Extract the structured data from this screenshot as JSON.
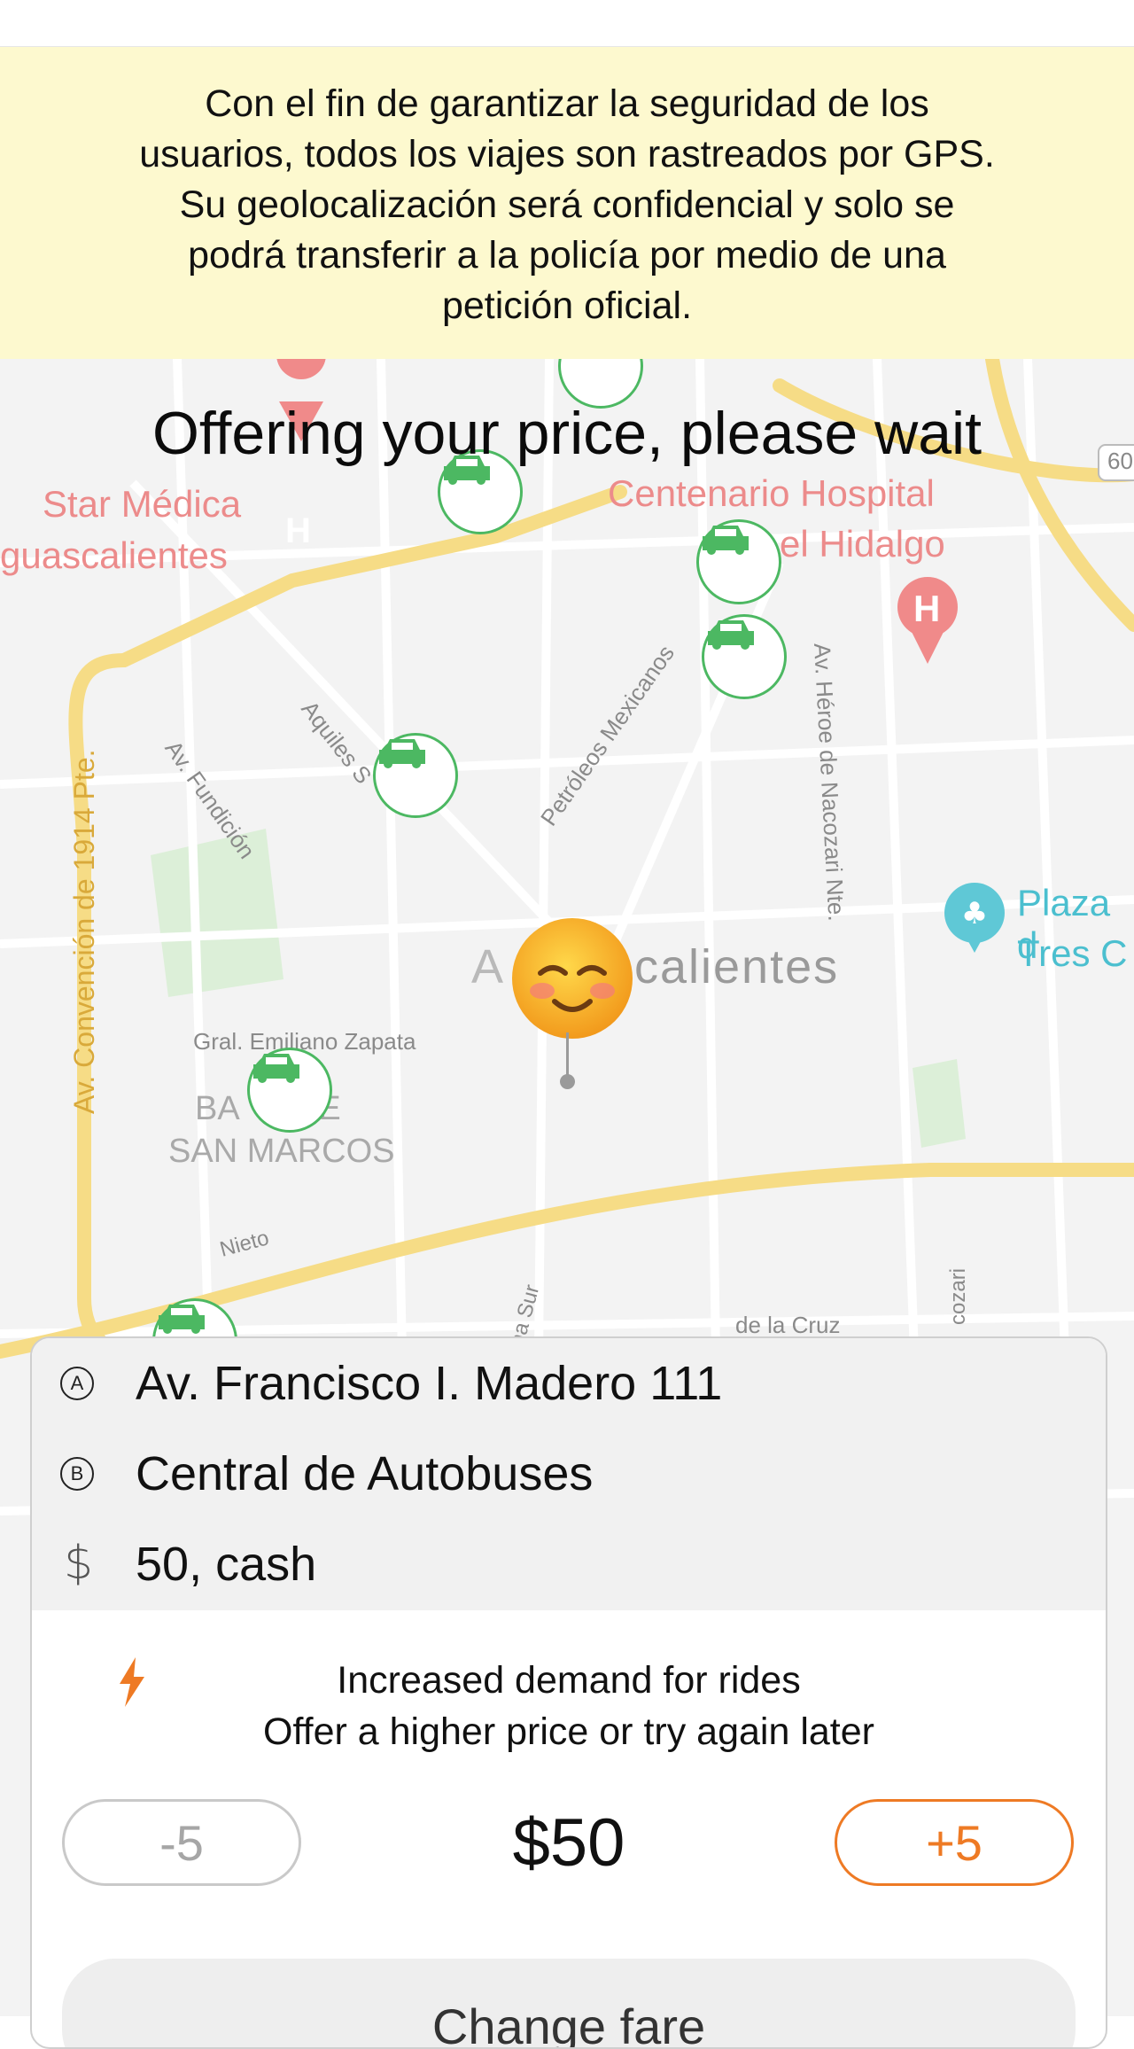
{
  "notice": {
    "line1": "Con el fin de garantizar la seguridad de los",
    "line2": "usuarios, todos los viajes son rastreados por GPS.",
    "line3": "Su geolocalización será confidencial y solo se",
    "line4": "podrá transferir a la policía por medio de una",
    "line5": "petición oficial."
  },
  "status": {
    "title": "Offering your price, please wait"
  },
  "map": {
    "labels": {
      "star_medica": "Star Médica",
      "aguascalientes_left": "guascalientes",
      "centenario": "Centenario Hospital",
      "hidalgo": "el Hidalgo",
      "aquiles": "Aquiles S",
      "fundicion": "Av. Fundición",
      "petroleos": "Petróleos Mexicanos",
      "heroe": "Av. Héroe de Nacozari Nte.",
      "convencion": "Av. Convención de 1914 Pte.",
      "plaza1": "Plaza d",
      "plaza2": "Tres C",
      "city_a": "A",
      "city_b": "calientes",
      "zapata": "Gral. Emiliano Zapata",
      "barrio1": "BA      DE",
      "barrio2": "SAN MARCOS",
      "nieto": "Nieto",
      "cruz": "de la Cruz",
      "sur": "na Sur",
      "cozari": "cozari",
      "road60": "60",
      "hospital_glyph": "H"
    },
    "colors": {
      "road": "#f6dc86",
      "poi": "#f08a8a",
      "water": "#5fc8d6",
      "park": "#dcefd8",
      "car": "#4cb862"
    }
  },
  "route": {
    "a_badge": "A",
    "a_address": "Av. Francisco I. Madero 111",
    "b_badge": "B",
    "b_address": "Central de Autobuses",
    "price_symbol": "$",
    "price_text": "50, cash"
  },
  "demand": {
    "line1": "Increased demand for rides",
    "line2": "Offer a higher price or try again later"
  },
  "controls": {
    "minus_label": "-5",
    "price_value": "$50",
    "plus_label": "+5",
    "accent": "#ee7a24",
    "main_button_label": "Change fare"
  }
}
